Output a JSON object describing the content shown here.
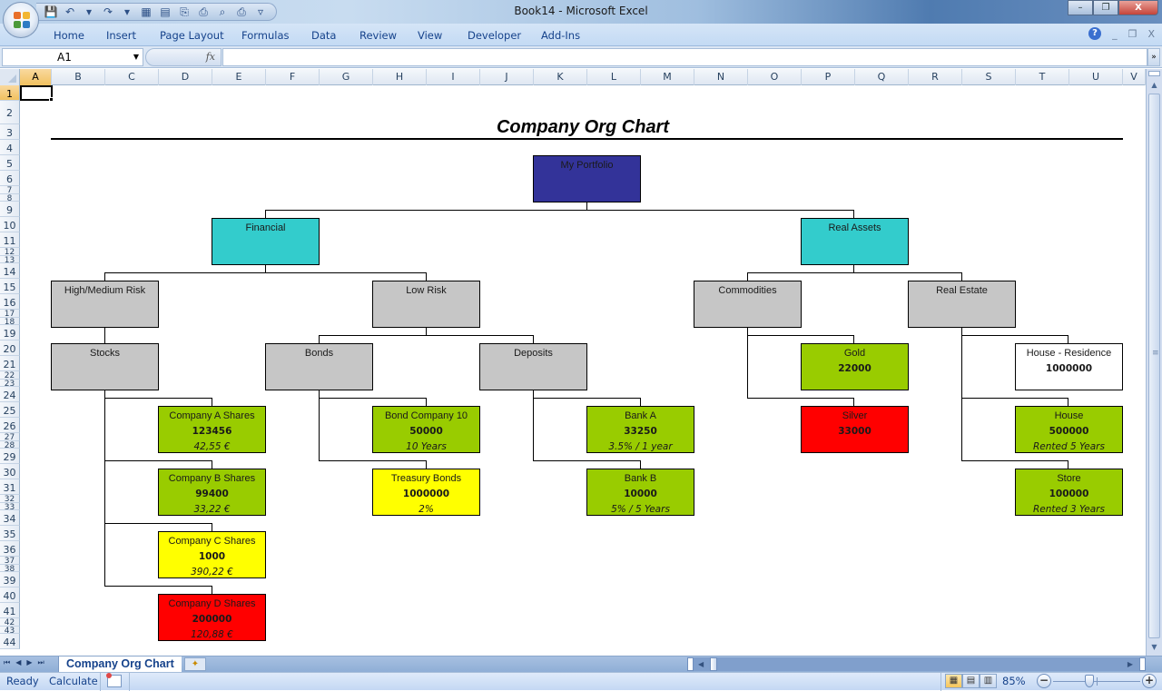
{
  "window": {
    "title": "Book14  -  Microsoft Excel",
    "minimize_label": "–",
    "restore_label": "❐",
    "close_label": "X"
  },
  "quick_access": [
    {
      "name": "save-icon",
      "glyph": "💾"
    },
    {
      "name": "undo-icon",
      "glyph": "↶"
    },
    {
      "name": "undo-dropdown-icon",
      "glyph": "▾"
    },
    {
      "name": "redo-icon",
      "glyph": "↷"
    },
    {
      "name": "redo-dropdown-icon",
      "glyph": "▾"
    },
    {
      "name": "calculator-icon",
      "glyph": "▦"
    },
    {
      "name": "table-icon",
      "glyph": "▤"
    },
    {
      "name": "paste-special-icon",
      "glyph": "⎘"
    },
    {
      "name": "document-icon",
      "glyph": "⎙"
    },
    {
      "name": "print-preview-icon",
      "glyph": "⌕"
    },
    {
      "name": "print-icon",
      "glyph": "⎙"
    },
    {
      "name": "customize-qat-icon",
      "glyph": "▿"
    }
  ],
  "ribbon": {
    "tabs": [
      "Home",
      "Insert",
      "Page Layout",
      "Formulas",
      "Data",
      "Review",
      "View",
      "Developer",
      "Add-Ins"
    ],
    "help_label": "?",
    "mini_minimize": "_",
    "mini_restore": "❐",
    "mini_close": "X"
  },
  "formula_bar": {
    "name_box": "A1",
    "fx_label": "fx",
    "formula": "",
    "expand_label": "»"
  },
  "grid": {
    "columns": [
      "A",
      "B",
      "C",
      "D",
      "E",
      "F",
      "G",
      "H",
      "I",
      "J",
      "K",
      "L",
      "M",
      "N",
      "O",
      "P",
      "Q",
      "R",
      "S",
      "T",
      "U",
      "V"
    ],
    "rows": [
      "1",
      "2",
      "3",
      "4",
      "5",
      "6",
      "7",
      "8",
      "9",
      "10",
      "11",
      "12",
      "13",
      "14",
      "15",
      "16",
      "17",
      "18",
      "19",
      "20",
      "21",
      "22",
      "23",
      "24",
      "25",
      "26",
      "27",
      "28",
      "29",
      "30",
      "31",
      "32",
      "33",
      "34",
      "35",
      "36",
      "37",
      "38",
      "39",
      "40",
      "41",
      "42",
      "43",
      "44"
    ],
    "active_column": "A",
    "active_row": "1"
  },
  "chart": {
    "title": "Company Org Chart",
    "nodes": {
      "portfolio": {
        "label": "My Portfolio",
        "color": "#333399"
      },
      "financial": {
        "label": "Financial",
        "color": "#33CCCC"
      },
      "real_assets": {
        "label": "Real Assets",
        "color": "#33CCCC"
      },
      "high_medium_risk": {
        "label": "High/Medium Risk",
        "color": "#C6C6C6"
      },
      "low_risk": {
        "label": "Low Risk",
        "color": "#C6C6C6"
      },
      "commodities": {
        "label": "Commodities",
        "color": "#C6C6C6"
      },
      "real_estate": {
        "label": "Real Estate",
        "color": "#C6C6C6"
      },
      "stocks": {
        "label": "Stocks",
        "color": "#C6C6C6"
      },
      "bonds": {
        "label": "Bonds",
        "color": "#C6C6C6"
      },
      "deposits": {
        "label": "Deposits",
        "color": "#C6C6C6"
      },
      "gold": {
        "label": "Gold",
        "value": "22000",
        "note": "",
        "color": "#99CC00"
      },
      "silver": {
        "label": "Silver",
        "value": "33000",
        "note": "",
        "color": "#FF0000"
      },
      "house_residence": {
        "label": "House - Residence",
        "value": "1000000",
        "note": "",
        "color": "#FFFFFF"
      },
      "house": {
        "label": "House",
        "value": "500000",
        "note": "Rented 5 Years",
        "color": "#99CC00"
      },
      "store": {
        "label": "Store",
        "value": "100000",
        "note": "Rented 3 Years",
        "color": "#99CC00"
      },
      "company_a": {
        "label": "Company A Shares",
        "value": "123456",
        "note": "42,55 €",
        "color": "#99CC00"
      },
      "company_b": {
        "label": "Company B Shares",
        "value": "99400",
        "note": "33,22 €",
        "color": "#99CC00"
      },
      "company_c": {
        "label": "Company C Shares",
        "value": "1000",
        "note": "390,22 €",
        "color": "#FFFF00"
      },
      "company_d": {
        "label": "Company D Shares",
        "value": "200000",
        "note": "120,88 €",
        "color": "#FF0000"
      },
      "bond_company_10": {
        "label": "Bond Company 10",
        "value": "50000",
        "note": "10 Years",
        "color": "#99CC00"
      },
      "treasury_bonds": {
        "label": "Treasury Bonds",
        "value": "1000000",
        "note": "2%",
        "color": "#FFFF00"
      },
      "bank_a": {
        "label": "Bank A",
        "value": "33250",
        "note": "3.5% / 1 year",
        "color": "#99CC00"
      },
      "bank_b": {
        "label": "Bank B",
        "value": "10000",
        "note": "5% / 5 Years",
        "color": "#99CC00"
      }
    }
  },
  "sheet_tabs": {
    "nav": [
      "⏮",
      "◀",
      "▶",
      "⏭"
    ],
    "active": "Company Org Chart",
    "insert_label": "✦"
  },
  "status_bar": {
    "ready": "Ready",
    "calculate": "Calculate",
    "zoom": "85%",
    "zoom_level_percent": 85,
    "zoom_minus": "−",
    "zoom_plus": "+",
    "view_normal": "▦",
    "view_page_layout": "▤",
    "view_page_break": "▥"
  }
}
